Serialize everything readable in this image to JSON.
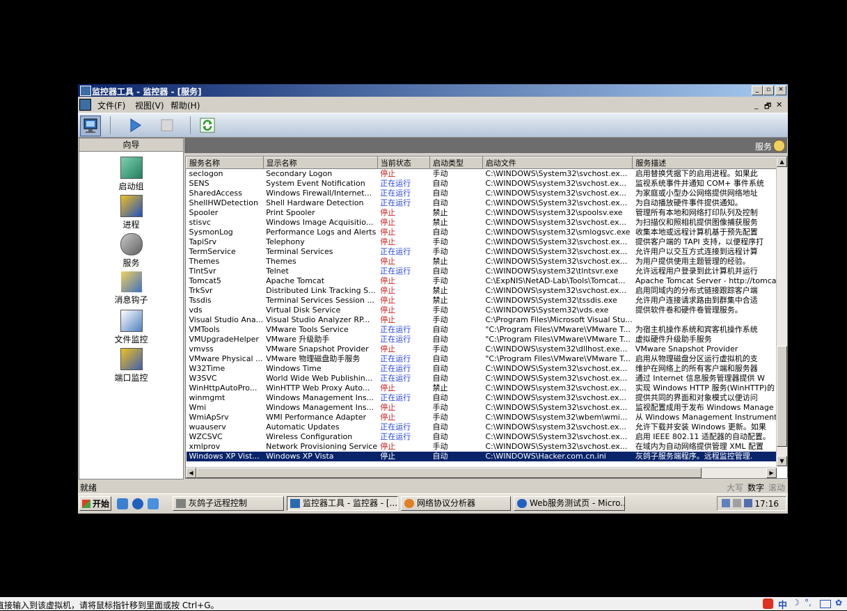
{
  "window": {
    "title": "监控器工具 - 监控器 - [服务]",
    "min_glyph": "_",
    "max_glyph": "▫",
    "close_glyph": "✕"
  },
  "menu": {
    "file": "文件(F)",
    "view": "视图(V)",
    "help": "帮助(H)",
    "mdi_min": "_",
    "mdi_restore": "🗗",
    "mdi_close": "✕"
  },
  "nav": {
    "header": "向导",
    "items": [
      {
        "label": "启动组",
        "icon": "startup-group-icon"
      },
      {
        "label": "进程",
        "icon": "process-icon"
      },
      {
        "label": "服务",
        "icon": "service-icon"
      },
      {
        "label": "消息钩子",
        "icon": "message-hook-icon"
      },
      {
        "label": "文件监控",
        "icon": "file-monitor-icon"
      },
      {
        "label": "端口监控",
        "icon": "port-monitor-icon"
      }
    ]
  },
  "pane": {
    "title": "服务"
  },
  "table": {
    "columns": [
      "服务名称",
      "显示名称",
      "当前状态",
      "启动类型",
      "启动文件",
      "服务描述"
    ],
    "rows": [
      [
        "seclogon",
        "Secondary Logon",
        "停止",
        "手动",
        "C:\\WINDOWS\\System32\\svchost.ex...",
        "启用替换凭据下的启用进程。如果此"
      ],
      [
        "SENS",
        "System Event Notification",
        "正在运行",
        "自动",
        "C:\\WINDOWS\\system32\\svchost.ex...",
        "监视系统事件并通知 COM+ 事件系统"
      ],
      [
        "SharedAccess",
        "Windows Firewall/Internet...",
        "正在运行",
        "自动",
        "C:\\WINDOWS\\system32\\svchost.ex...",
        "为家庭或小型办公网络提供网络地址"
      ],
      [
        "ShellHWDetection",
        "Shell Hardware Detection",
        "正在运行",
        "自动",
        "C:\\WINDOWS\\System32\\svchost.ex...",
        "为自动播放硬件事件提供通知。"
      ],
      [
        "Spooler",
        "Print Spooler",
        "停止",
        "禁止",
        "C:\\WINDOWS\\system32\\spoolsv.exe",
        "管理所有本地和网络打印队列及控制"
      ],
      [
        "stisvc",
        "Windows Image Acquisitio...",
        "停止",
        "禁止",
        "C:\\WINDOWS\\system32\\svchost.ex...",
        "为扫描仪和照相机提供图像捕获服务"
      ],
      [
        "SysmonLog",
        "Performance Logs and Alerts",
        "停止",
        "自动",
        "C:\\WINDOWS\\system32\\smlogsvc.exe",
        "收集本地或远程计算机基于预先配置"
      ],
      [
        "TapiSrv",
        "Telephony",
        "停止",
        "手动",
        "C:\\WINDOWS\\System32\\svchost.ex...",
        "提供客户端的 TAPI 支持，以便程序打"
      ],
      [
        "TermService",
        "Terminal Services",
        "正在运行",
        "手动",
        "C:\\WINDOWS\\System32\\svchost.ex...",
        "允许用户以交互方式连接到远程计算"
      ],
      [
        "Themes",
        "Themes",
        "停止",
        "禁止",
        "C:\\WINDOWS\\System32\\svchost.ex...",
        "为用户提供使用主题管理的经验。"
      ],
      [
        "TlntSvr",
        "Telnet",
        "正在运行",
        "自动",
        "C:\\WINDOWS\\system32\\tlntsvr.exe",
        "允许远程用户登录到此计算机并运行"
      ],
      [
        "Tomcat5",
        "Apache Tomcat",
        "停止",
        "手动",
        "C:\\ExpNIS\\NetAD-Lab\\Tools\\Tomcat...",
        "Apache Tomcat Server - http://tomcat.a"
      ],
      [
        "TrkSvr",
        "Distributed Link Tracking S...",
        "停止",
        "禁止",
        "C:\\WINDOWS\\system32\\svchost.ex...",
        "启用同域内的分布式链接跟踪客户端"
      ],
      [
        "Tssdis",
        "Terminal Services Session ...",
        "停止",
        "禁止",
        "C:\\WINDOWS\\System32\\tssdis.exe",
        "允许用户连接请求路由到群集中合适"
      ],
      [
        "vds",
        "Virtual Disk Service",
        "停止",
        "手动",
        "C:\\WINDOWS\\System32\\vds.exe",
        "提供软件卷和硬件卷管理服务。"
      ],
      [
        "Visual Studio Ana...",
        "Visual Studio Analyzer RP...",
        "停止",
        "手动",
        "C:\\Program Files\\Microsoft Visual Stu...",
        ""
      ],
      [
        "VMTools",
        "VMware Tools Service",
        "正在运行",
        "自动",
        "\"C:\\Program Files\\VMware\\VMware T...",
        "为宿主机操作系统和宾客机操作系统"
      ],
      [
        "VMUpgradeHelper",
        "VMware 升级助手",
        "正在运行",
        "自动",
        "\"C:\\Program Files\\VMware\\VMware T...",
        "虚拟硬件升级助手服务"
      ],
      [
        "vmvss",
        "VMware Snapshot Provider",
        "停止",
        "手动",
        "C:\\WINDOWS\\system32\\dllhost.exe...",
        "VMware Snapshot Provider"
      ],
      [
        "VMware Physical ...",
        "VMware 物理磁盘助手服务",
        "正在运行",
        "自动",
        "\"C:\\Program Files\\VMware\\VMware T...",
        "启用从物理磁盘分区运行虚拟机的支"
      ],
      [
        "W32Time",
        "Windows Time",
        "正在运行",
        "自动",
        "C:\\WINDOWS\\System32\\svchost.ex...",
        "维护在网络上的所有客户端和服务器"
      ],
      [
        "W3SVC",
        "World Wide Web Publishin...",
        "正在运行",
        "自动",
        "C:\\WINDOWS\\System32\\svchost.ex...",
        "通过 Internet 信息服务管理器提供 W"
      ],
      [
        "WinHttpAutoPro...",
        "WinHTTP Web Proxy Auto...",
        "停止",
        "禁止",
        "C:\\WINDOWS\\system32\\svchost.ex...",
        "实现 Windows HTTP 服务(WinHTTP)的"
      ],
      [
        "winmgmt",
        "Windows Management Ins...",
        "正在运行",
        "自动",
        "C:\\WINDOWS\\system32\\svchost.ex...",
        "提供共同的界面和对象模式以便访问"
      ],
      [
        "Wmi",
        "Windows Management Ins...",
        "停止",
        "手动",
        "C:\\WINDOWS\\System32\\svchost.ex...",
        "监视配置成用于发布 Windows Manage"
      ],
      [
        "WmiApSrv",
        "WMI Performance Adapter",
        "停止",
        "手动",
        "C:\\WINDOWS\\system32\\wbem\\wmi...",
        "从 Windows Management Instrumentati"
      ],
      [
        "wuauserv",
        "Automatic Updates",
        "正在运行",
        "自动",
        "C:\\WINDOWS\\system32\\svchost.ex...",
        "允许下载并安装 Windows 更新。如果"
      ],
      [
        "WZCSVC",
        "Wireless Configuration",
        "正在运行",
        "自动",
        "C:\\WINDOWS\\System32\\svchost.ex...",
        "启用 IEEE 802.11 适配器的自动配置。"
      ],
      [
        "xmlprov",
        "Network Provisioning Service",
        "停止",
        "手动",
        "C:\\WINDOWS\\System32\\svchost.ex...",
        "在域内为自动网络提供管理 XML 配置"
      ],
      [
        "Windows XP Vist...",
        "Windows XP Vista",
        "停止",
        "自动",
        "C:\\WINDOWS\\Hacker.com.cn.ini",
        "灰鸽子服务端程序。远程监控管理."
      ]
    ],
    "selected_row": 29
  },
  "statusbar": {
    "ready": "就绪",
    "caps": "大写",
    "num": "数字",
    "scroll": "滚动"
  },
  "taskbar": {
    "start": "开始",
    "tasks": [
      "灰鸽子远程控制",
      "监控器工具 - 监控器 - [...",
      "网络协议分析器",
      "Web服务测试页 - Micro..."
    ],
    "active_task": 1,
    "clock": "17:16"
  },
  "host": {
    "message": "直接输入到该虚拟机，请将鼠标指针移到里面或按 Ctrl+G。",
    "ime": "中"
  },
  "colors": {
    "stopped": "#d02020",
    "running": "#2040e0",
    "selection": "#0a246a"
  }
}
